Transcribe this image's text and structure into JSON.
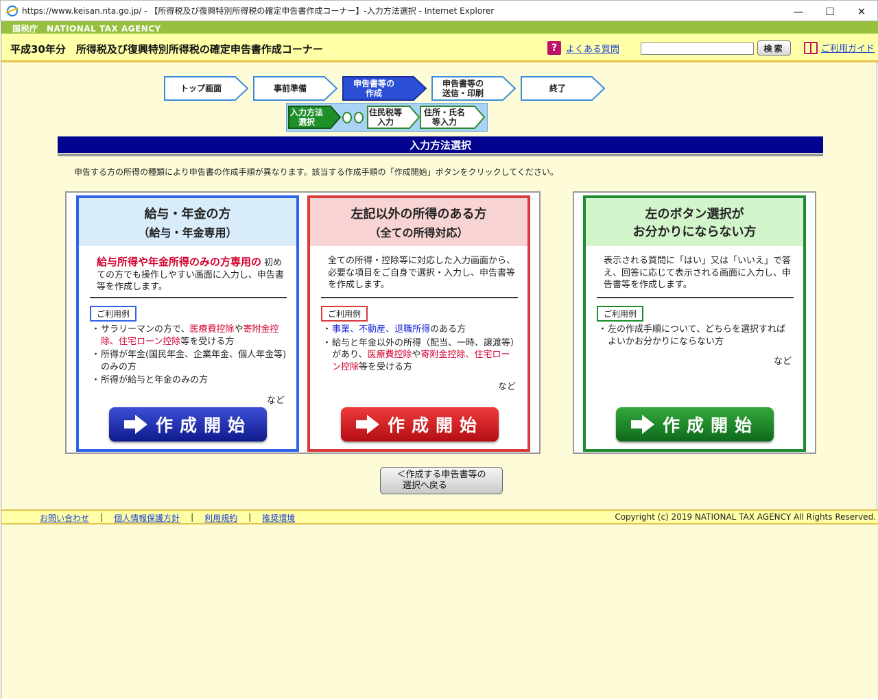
{
  "window": {
    "title": "https://www.keisan.nta.go.jp/ - 【所得税及び復興特別所得税の確定申告書作成コーナー】-入力方法選択 - Internet Explorer",
    "minimize": "—",
    "maximize": "☐",
    "close": "✕"
  },
  "agency": {
    "name": "国税庁　NATIONAL TAX AGENCY"
  },
  "header": {
    "page_heading": "平成30年分　所得税及び復興特別所得税の確定申告書作成コーナー",
    "faq_icon": "?",
    "faq_label": "よくある質問",
    "search_placeholder": "",
    "search_button": "検索",
    "guide_label": "ご利用ガイド"
  },
  "steps": {
    "top": "トップ画面",
    "prep": "事前準備",
    "create_l1": "申告書等の",
    "create_l2": "作成",
    "send_l1": "申告書等の",
    "send_l2": "送信・印刷",
    "end": "終了"
  },
  "substeps": {
    "method_l1": "入力方法",
    "method_l2": "選択",
    "resident_l1": "住民税等",
    "resident_l2": "入力",
    "address_l1": "住所・氏名",
    "address_l2": "等入力"
  },
  "page": {
    "title": "入力方法選択",
    "instruction": "申告する方の所得の種類により申告書の作成手順が異なります。該当する作成手順の「作成開始」ボタンをクリックしてください。"
  },
  "cards": {
    "salary": {
      "title_l1": "給与・年金の方",
      "title_l2": "（給与・年金専用）",
      "desc_strong": "給与所得や年金所得のみの方専用の",
      "desc_rest": " 初めての方でも操作しやすい画面に入力し、申告書等を作成します。",
      "usage_label": "ご利用例",
      "u1_a": "サラリーマンの方で、",
      "u1_b": "医療費控除",
      "u1_c": "や",
      "u1_d": "寄附金控除",
      "u1_e": "、",
      "u1_f": "住宅ローン控除",
      "u1_g": "等を受ける方",
      "u2": "所得が年金(国民年金、企業年金、個人年金等)のみの方",
      "u3": "所得が給与と年金のみの方",
      "etc": "など",
      "start": "作成開始"
    },
    "other": {
      "title_l1": "左記以外の所得のある方",
      "title_l2": "（全ての所得対応）",
      "desc": "全ての所得・控除等に対応した入力画面から、必要な項目をご自身で選択・入力し、申告書等を作成します。",
      "usage_label": "ご利用例",
      "u1_a": "事業",
      "u1_b": "、",
      "u1_c": "不動産",
      "u1_d": "、",
      "u1_e": "退職所得",
      "u1_f": "のある方",
      "u2_a": "給与と年金以外の所得（配当、一時、譲渡等）があり、",
      "u2_b": "医療費控除",
      "u2_c": "や",
      "u2_d": "寄附金控除",
      "u2_e": "、",
      "u2_f": "住宅ローン控除",
      "u2_g": "等を受ける方",
      "etc": "など",
      "start": "作成開始"
    },
    "unsure": {
      "title_l1": "左のボタン選択が",
      "title_l2": "お分かりにならない方",
      "desc": "表示される質問に「はい」又は「いいえ」で答え、回答に応じて表示される画面に入力し、申告書等を作成します。",
      "usage_label": "ご利用例",
      "u1": "左の作成手順について、どちらを選択すればよいかお分かりにならない方",
      "etc": "など",
      "start": "作成開始"
    }
  },
  "back": {
    "l1": "＜作成する申告書等の",
    "l2": "選択へ戻る"
  },
  "footer": {
    "contact": "お問い合わせ",
    "privacy": "個人情報保護方針",
    "terms": "利用規約",
    "env": "推奨環境",
    "sep": "|",
    "copyright": "Copyright (c) 2019 NATIONAL TAX AGENCY All Rights Reserved."
  },
  "colors": {
    "agency_green": "#97c03e",
    "header_yellow": "#ffffa8",
    "title_navy": "#02038f",
    "salary_blue": "#2f63e8",
    "other_red": "#d93a3a",
    "unsure_green": "#1f8c2f"
  }
}
